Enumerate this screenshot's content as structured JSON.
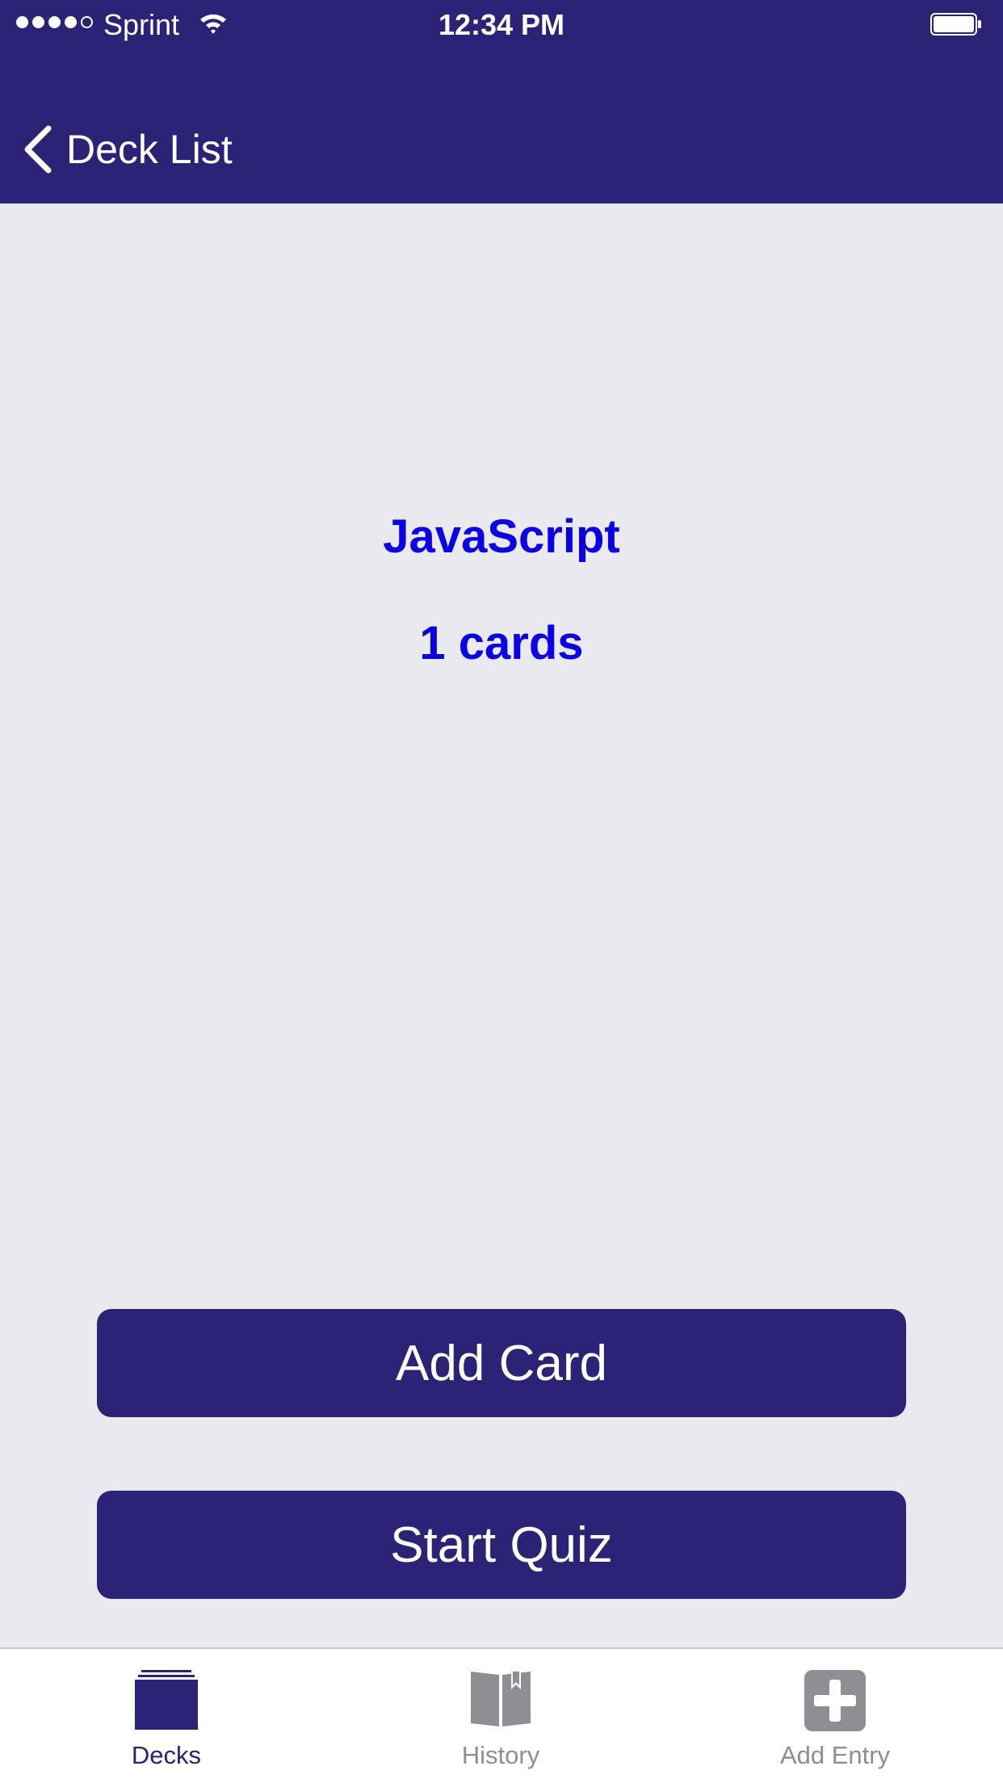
{
  "colors": {
    "primary": "#2A2376",
    "background": "#E9E9EF",
    "deck_text": "#0A00E6",
    "tab_inactive": "#8E8E93",
    "white": "#FFFFFF"
  },
  "status_bar": {
    "carrier": "Sprint",
    "time": "12:34 PM",
    "signal_bars_filled": 4,
    "signal_bars_total": 5,
    "icons": [
      "wifi-icon",
      "battery-icon"
    ]
  },
  "nav": {
    "back_label": "Deck List",
    "back_icon": "chevron-left-icon"
  },
  "deck": {
    "title": "JavaScript",
    "card_count": "1 cards"
  },
  "actions": {
    "add_card_label": "Add Card",
    "start_quiz_label": "Start Quiz"
  },
  "tab_bar": {
    "tabs": [
      {
        "label": "Decks",
        "icon": "decks-icon",
        "active": true
      },
      {
        "label": "History",
        "icon": "book-icon",
        "active": false
      },
      {
        "label": "Add Entry",
        "icon": "plus-square-icon",
        "active": false
      }
    ]
  }
}
